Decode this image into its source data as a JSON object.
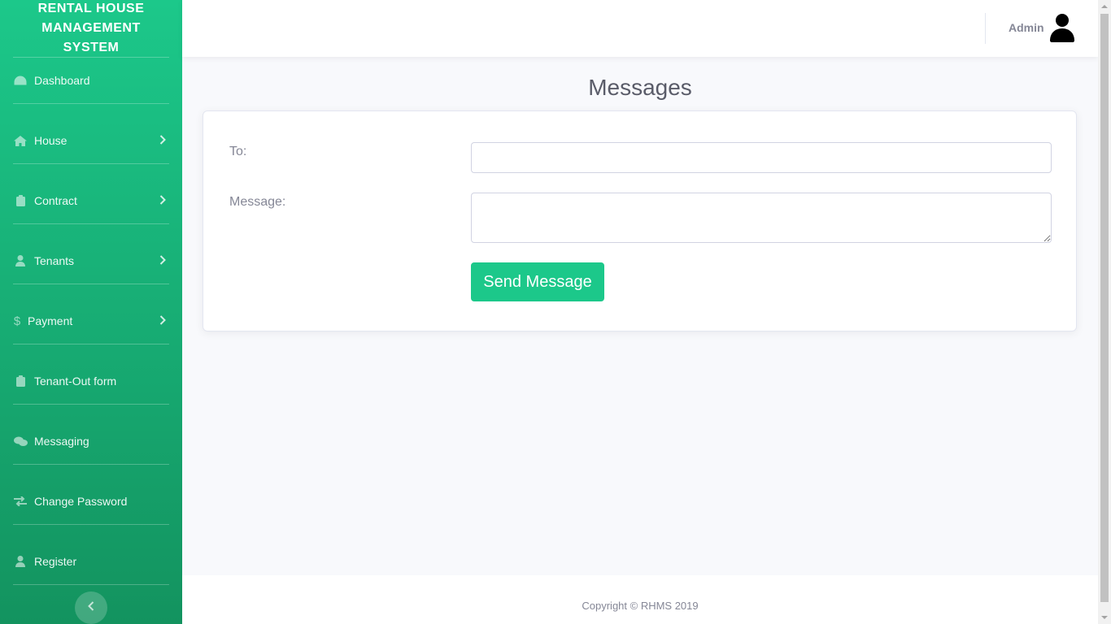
{
  "sidebar": {
    "brand_lines": [
      "RENTAL HOUSE",
      "MANAGEMENT",
      "SYSTEM"
    ],
    "items": [
      {
        "label": "Dashboard",
        "icon": "tachometer-icon",
        "has_submenu": false
      },
      {
        "label": "House",
        "icon": "home-icon",
        "has_submenu": true
      },
      {
        "label": "Contract",
        "icon": "clipboard-icon",
        "has_submenu": true
      },
      {
        "label": "Tenants",
        "icon": "user-icon",
        "has_submenu": true
      },
      {
        "label": "Payment",
        "icon": "dollar-icon",
        "has_submenu": true
      },
      {
        "label": "Tenant-Out form",
        "icon": "clipboard-icon",
        "has_submenu": false
      },
      {
        "label": "Messaging",
        "icon": "comments-icon",
        "has_submenu": false
      },
      {
        "label": "Change Password",
        "icon": "exchange-icon",
        "has_submenu": false
      },
      {
        "label": "Register",
        "icon": "user-icon",
        "has_submenu": false
      }
    ]
  },
  "topbar": {
    "user_name": "Admin"
  },
  "main": {
    "title": "Messages",
    "form": {
      "to_label": "To:",
      "to_value": "",
      "message_label": "Message:",
      "message_value": "",
      "send_label": "Send Message"
    }
  },
  "footer": {
    "copyright": "Copyright © RHMS 2019"
  },
  "colors": {
    "primary": "#1cc88a",
    "sidebar_end": "#13935f",
    "text_muted": "#858796"
  }
}
